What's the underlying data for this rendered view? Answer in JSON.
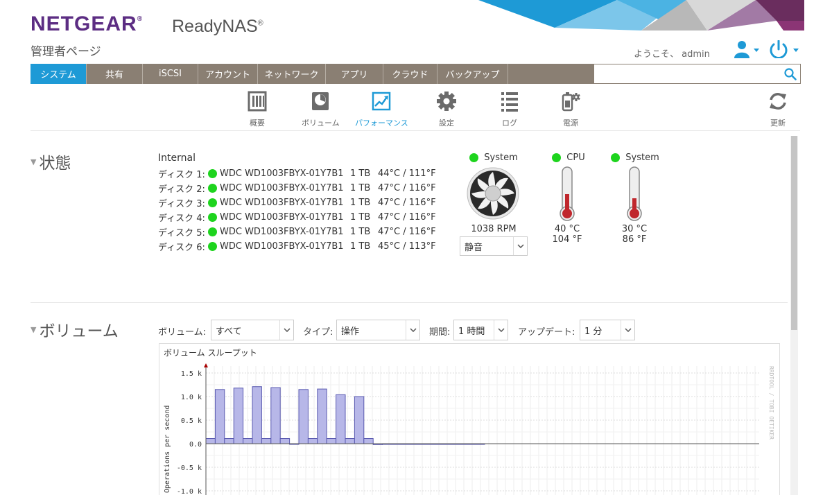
{
  "header": {
    "brand": "NETGEAR",
    "brand_mark": "®",
    "product": "ReadyNAS",
    "product_mark": "®",
    "page_title": "管理者ページ",
    "welcome": "ようこそ、 admin",
    "accent_color": "#1e9ad6",
    "brand_color": "#5c2d83"
  },
  "nav": {
    "tabs": [
      {
        "label": "システム",
        "active": true
      },
      {
        "label": "共有"
      },
      {
        "label": "iSCSI"
      },
      {
        "label": "アカウント"
      },
      {
        "label": "ネットワーク"
      },
      {
        "label": "アプリ"
      },
      {
        "label": "クラウド"
      },
      {
        "label": "バックアップ"
      }
    ],
    "search_placeholder": ""
  },
  "subnav": {
    "items": [
      {
        "label": "概要",
        "icon": "overview-icon"
      },
      {
        "label": "ボリューム",
        "icon": "volume-icon"
      },
      {
        "label": "パフォーマンス",
        "icon": "performance-icon",
        "active": true
      },
      {
        "label": "設定",
        "icon": "gear-icon"
      },
      {
        "label": "ログ",
        "icon": "log-icon"
      },
      {
        "label": "電源",
        "icon": "power-icon"
      }
    ],
    "refresh_label": "更新"
  },
  "status": {
    "title": "状態",
    "internal": "Internal",
    "disks": [
      {
        "name": "ディスク 1:",
        "model": "WDC WD1003FBYX-01Y7B1",
        "capacity": "1 TB",
        "temp": "44°C / 111°F"
      },
      {
        "name": "ディスク 2:",
        "model": "WDC WD1003FBYX-01Y7B1",
        "capacity": "1 TB",
        "temp": "47°C / 116°F"
      },
      {
        "name": "ディスク 3:",
        "model": "WDC WD1003FBYX-01Y7B1",
        "capacity": "1 TB",
        "temp": "47°C / 116°F"
      },
      {
        "name": "ディスク 4:",
        "model": "WDC WD1003FBYX-01Y7B1",
        "capacity": "1 TB",
        "temp": "47°C / 116°F"
      },
      {
        "name": "ディスク 5:",
        "model": "WDC WD1003FBYX-01Y7B1",
        "capacity": "1 TB",
        "temp": "47°C / 116°F"
      },
      {
        "name": "ディスク 6:",
        "model": "WDC WD1003FBYX-01Y7B1",
        "capacity": "1 TB",
        "temp": "45°C / 113°F"
      }
    ],
    "fan": {
      "title": "System",
      "rpm": "1038 RPM",
      "mode": "静音"
    },
    "cpu": {
      "title": "CPU",
      "c": "40 °C",
      "f": "104 °F"
    },
    "system_temp": {
      "title": "System",
      "c": "30 °C",
      "f": "86 °F"
    }
  },
  "volume": {
    "title": "ボリューム",
    "filter_volume_label": "ボリューム:",
    "filter_volume_value": "すべて",
    "filter_type_label": "タイプ:",
    "filter_type_value": "操作",
    "filter_period_label": "期間:",
    "filter_period_value": "1 時間",
    "filter_update_label": "アップデート:",
    "filter_update_value": "1 分"
  },
  "chart_data": {
    "type": "area",
    "title": "ボリューム スループット",
    "ylabel": "Operations per second",
    "watermark": "RRDTOOL / TOBI OETIKER",
    "yticks": [
      "1.5 k",
      "1.0 k",
      "0.5 k",
      "0.0",
      "-0.5 k",
      "-1.0 k"
    ],
    "ytick_values": [
      1500,
      1000,
      500,
      0,
      -500,
      -1000
    ],
    "ylim": [
      -1000,
      1500
    ],
    "samples": [
      110,
      1150,
      110,
      1180,
      110,
      1210,
      110,
      1190,
      110,
      0,
      1150,
      110,
      1160,
      110,
      1040,
      110,
      1000,
      110,
      -20,
      0,
      0,
      0,
      0,
      0,
      0,
      0,
      0,
      0,
      0,
      0
    ],
    "fill_color": "#b7b7e8",
    "line_color": "#5a5ab0"
  }
}
